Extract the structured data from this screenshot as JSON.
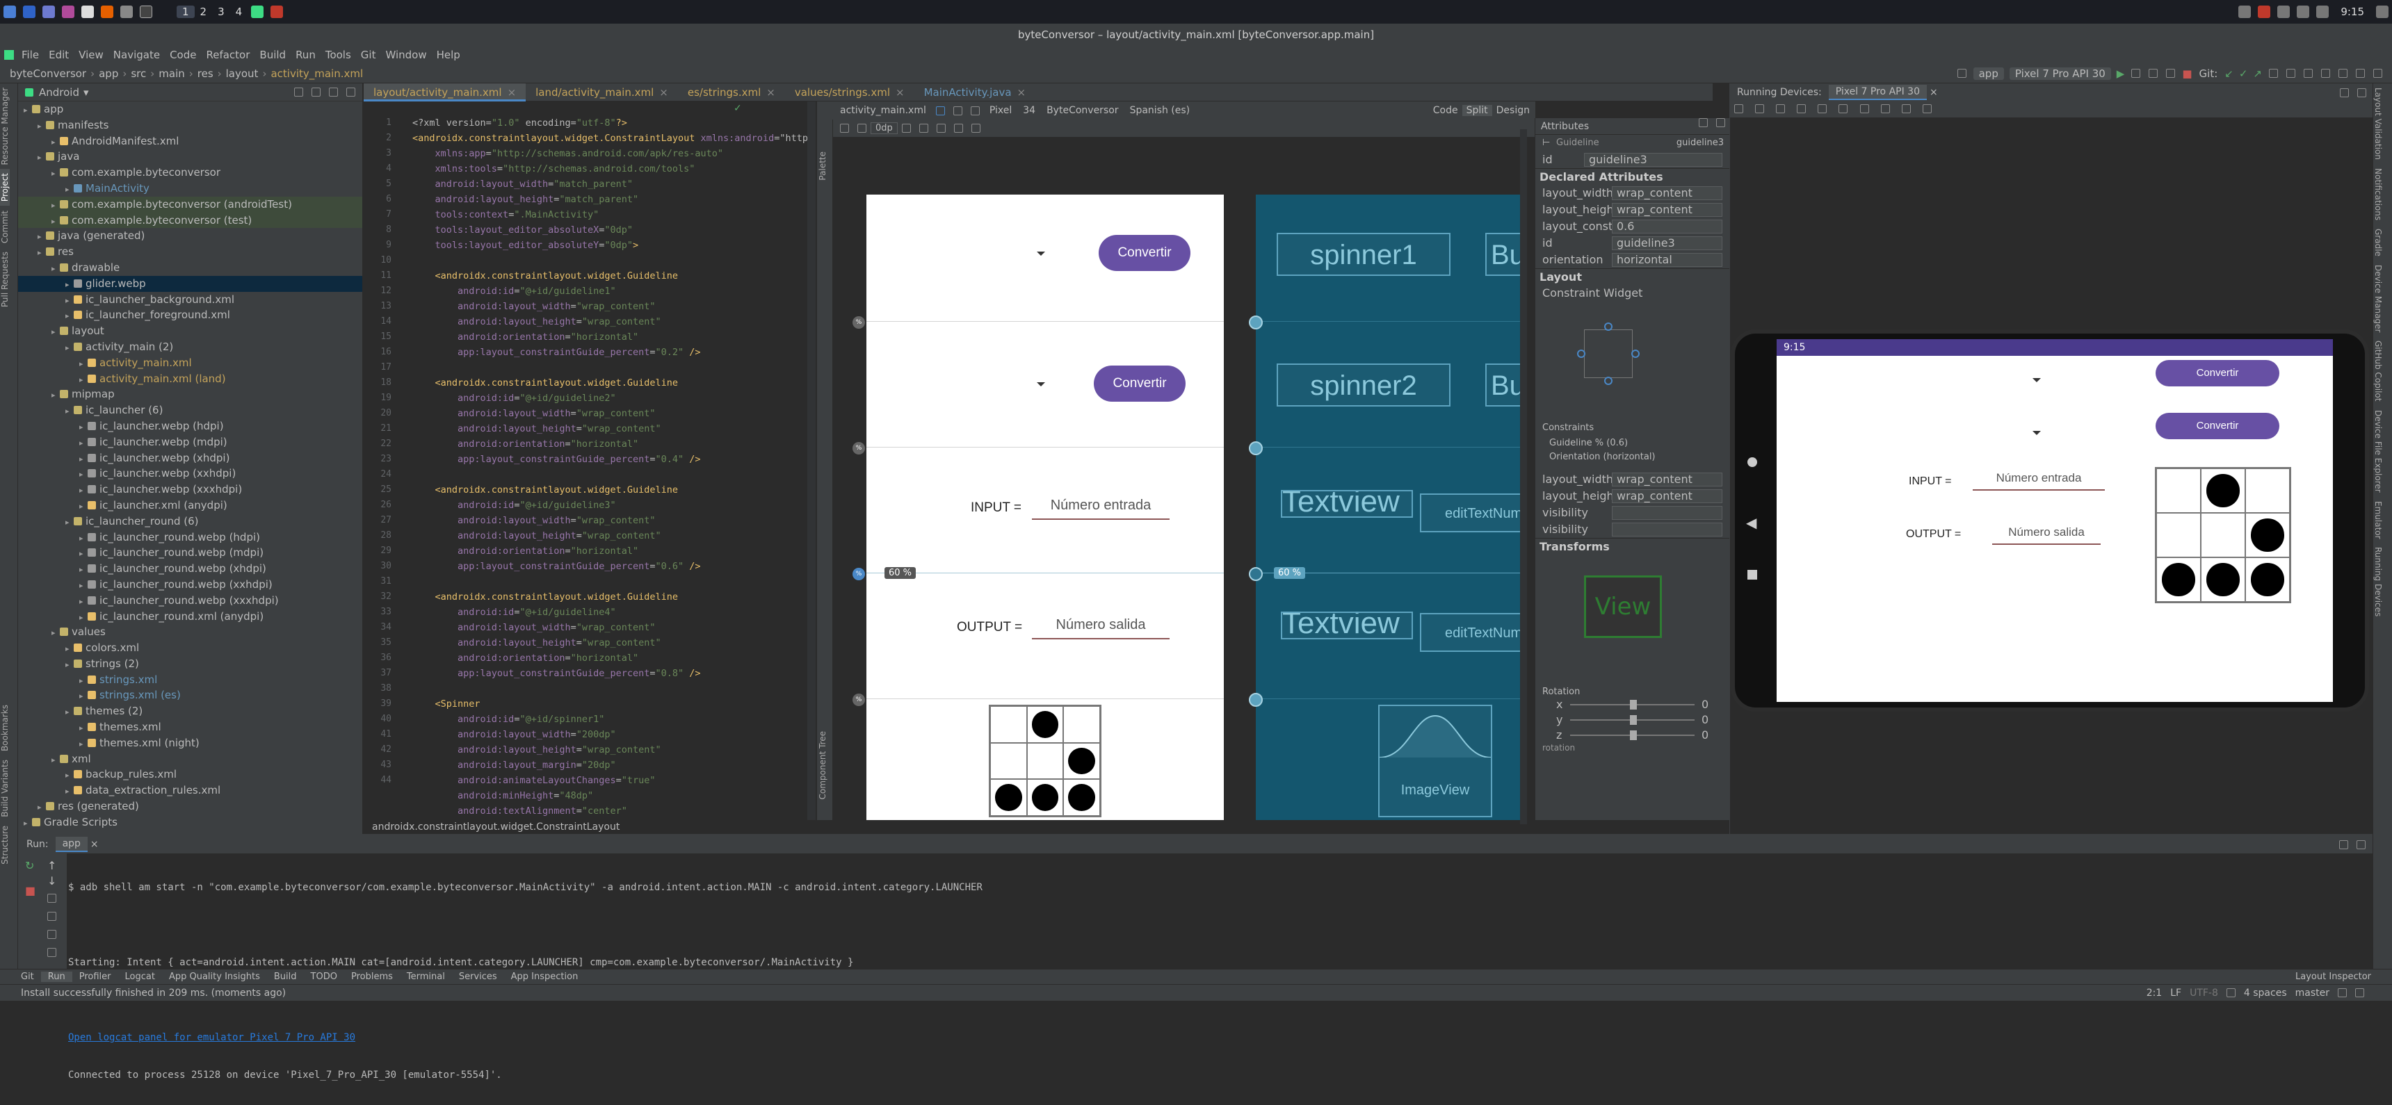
{
  "system_panel": {
    "workspaces": [
      "1",
      "2",
      "3",
      "4"
    ],
    "time": "9:15"
  },
  "window": {
    "title": "byteConversor – layout/activity_main.xml [byteConversor.app.main]"
  },
  "menu": [
    "File",
    "Edit",
    "View",
    "Navigate",
    "Code",
    "Refactor",
    "Build",
    "Run",
    "Tools",
    "Git",
    "Window",
    "Help"
  ],
  "breadcrumb": [
    "byteConversor",
    "app",
    "src",
    "main",
    "res",
    "layout",
    "activity_main.xml"
  ],
  "toolbar": {
    "run_config": "app",
    "device": "Pixel 7 Pro API 30",
    "git_label": "Git:"
  },
  "project": {
    "view": "Android",
    "tree": [
      {
        "d": 0,
        "t": "app",
        "c": "#c3b36a"
      },
      {
        "d": 1,
        "t": "manifests",
        "c": "#c3b36a"
      },
      {
        "d": 2,
        "t": "AndroidManifest.xml",
        "c": "#e8bf6a"
      },
      {
        "d": 1,
        "t": "java",
        "c": "#c3b36a"
      },
      {
        "d": 2,
        "t": "com.example.byteconversor",
        "c": "#c3b36a"
      },
      {
        "d": 3,
        "t": "MainActivity",
        "c": "#6897bb",
        "color": "#6897bb"
      },
      {
        "d": 2,
        "t": "com.example.byteconversor (androidTest)",
        "c": "#c3b36a",
        "hl": true
      },
      {
        "d": 2,
        "t": "com.example.byteconversor (test)",
        "c": "#c3b36a",
        "hl": true
      },
      {
        "d": 1,
        "t": "java (generated)",
        "c": "#c3b36a"
      },
      {
        "d": 1,
        "t": "res",
        "c": "#c3b36a"
      },
      {
        "d": 2,
        "t": "drawable",
        "c": "#c3b36a"
      },
      {
        "d": 3,
        "t": "glider.webp",
        "c": "#9b9b9b",
        "sel": true
      },
      {
        "d": 3,
        "t": "ic_launcher_background.xml",
        "c": "#e8bf6a"
      },
      {
        "d": 3,
        "t": "ic_launcher_foreground.xml",
        "c": "#e8bf6a"
      },
      {
        "d": 2,
        "t": "layout",
        "c": "#c3b36a"
      },
      {
        "d": 3,
        "t": "activity_main (2)",
        "c": "#c3b36a"
      },
      {
        "d": 4,
        "t": "activity_main.xml",
        "c": "#e8bf6a",
        "color": "#c4a35a"
      },
      {
        "d": 4,
        "t": "activity_main.xml (land)",
        "c": "#e8bf6a",
        "color": "#c4a35a"
      },
      {
        "d": 2,
        "t": "mipmap",
        "c": "#c3b36a"
      },
      {
        "d": 3,
        "t": "ic_launcher (6)",
        "c": "#c3b36a"
      },
      {
        "d": 4,
        "t": "ic_launcher.webp (hdpi)",
        "c": "#9b9b9b"
      },
      {
        "d": 4,
        "t": "ic_launcher.webp (mdpi)",
        "c": "#9b9b9b"
      },
      {
        "d": 4,
        "t": "ic_launcher.webp (xhdpi)",
        "c": "#9b9b9b"
      },
      {
        "d": 4,
        "t": "ic_launcher.webp (xxhdpi)",
        "c": "#9b9b9b"
      },
      {
        "d": 4,
        "t": "ic_launcher.webp (xxxhdpi)",
        "c": "#9b9b9b"
      },
      {
        "d": 4,
        "t": "ic_launcher.xml (anydpi)",
        "c": "#e8bf6a"
      },
      {
        "d": 3,
        "t": "ic_launcher_round (6)",
        "c": "#c3b36a"
      },
      {
        "d": 4,
        "t": "ic_launcher_round.webp (hdpi)",
        "c": "#9b9b9b"
      },
      {
        "d": 4,
        "t": "ic_launcher_round.webp (mdpi)",
        "c": "#9b9b9b"
      },
      {
        "d": 4,
        "t": "ic_launcher_round.webp (xhdpi)",
        "c": "#9b9b9b"
      },
      {
        "d": 4,
        "t": "ic_launcher_round.webp (xxhdpi)",
        "c": "#9b9b9b"
      },
      {
        "d": 4,
        "t": "ic_launcher_round.webp (xxxhdpi)",
        "c": "#9b9b9b"
      },
      {
        "d": 4,
        "t": "ic_launcher_round.xml (anydpi)",
        "c": "#e8bf6a"
      },
      {
        "d": 2,
        "t": "values",
        "c": "#c3b36a"
      },
      {
        "d": 3,
        "t": "colors.xml",
        "c": "#e8bf6a"
      },
      {
        "d": 3,
        "t": "strings (2)",
        "c": "#c3b36a"
      },
      {
        "d": 4,
        "t": "strings.xml",
        "c": "#e8bf6a",
        "color": "#6897bb"
      },
      {
        "d": 4,
        "t": "strings.xml (es)",
        "c": "#e8bf6a",
        "color": "#6897bb"
      },
      {
        "d": 3,
        "t": "themes (2)",
        "c": "#c3b36a"
      },
      {
        "d": 4,
        "t": "themes.xml",
        "c": "#e8bf6a"
      },
      {
        "d": 4,
        "t": "themes.xml (night)",
        "c": "#e8bf6a"
      },
      {
        "d": 2,
        "t": "xml",
        "c": "#c3b36a"
      },
      {
        "d": 3,
        "t": "backup_rules.xml",
        "c": "#e8bf6a"
      },
      {
        "d": 3,
        "t": "data_extraction_rules.xml",
        "c": "#e8bf6a"
      },
      {
        "d": 1,
        "t": "res (generated)",
        "c": "#c3b36a"
      },
      {
        "d": 0,
        "t": "Gradle Scripts",
        "c": "#c3b36a"
      }
    ]
  },
  "editor_tabs": [
    {
      "label": "layout/activity_main.xml",
      "active": true
    },
    {
      "label": "land/activity_main.xml"
    },
    {
      "label": "es/strings.xml"
    },
    {
      "label": "values/strings.xml"
    },
    {
      "label": "MainActivity.java",
      "blue": true
    }
  ],
  "code": {
    "line_numbers": [
      "1",
      "2",
      "3",
      "4",
      "5",
      "6",
      "7",
      "8",
      "9",
      "10",
      "11",
      "12",
      "13",
      "14",
      "15",
      "16",
      "17",
      "18",
      "19",
      "20",
      "21",
      "22",
      "23",
      "24",
      "25",
      "26",
      "27",
      "28",
      "29",
      "30",
      "31",
      "32",
      "33",
      "34",
      "35",
      "36",
      "37",
      "38",
      "39",
      "40",
      "41",
      "42",
      "43",
      "44"
    ],
    "lines": [
      "<?xml version=\"1.0\" encoding=\"utf-8\"?>",
      "<androidx.constraintlayout.widget.ConstraintLayout xmlns:android=\"http",
      "    xmlns:app=\"http://schemas.android.com/apk/res-auto\"",
      "    xmlns:tools=\"http://schemas.android.com/tools\"",
      "    android:layout_width=\"match_parent\"",
      "    android:layout_height=\"match_parent\"",
      "    tools:context=\".MainActivity\"",
      "    tools:layout_editor_absoluteX=\"0dp\"",
      "    tools:layout_editor_absoluteY=\"0dp\">",
      "",
      "    <androidx.constraintlayout.widget.Guideline",
      "        android:id=\"@+id/guideline1\"",
      "        android:layout_width=\"wrap_content\"",
      "        android:layout_height=\"wrap_content\"",
      "        android:orientation=\"horizontal\"",
      "        app:layout_constraintGuide_percent=\"0.2\" />",
      "",
      "    <androidx.constraintlayout.widget.Guideline",
      "        android:id=\"@+id/guideline2\"",
      "        android:layout_width=\"wrap_content\"",
      "        android:layout_height=\"wrap_content\"",
      "        android:orientation=\"horizontal\"",
      "        app:layout_constraintGuide_percent=\"0.4\" />",
      "",
      "    <androidx.constraintlayout.widget.Guideline",
      "        android:id=\"@+id/guideline3\"",
      "        android:layout_width=\"wrap_content\"",
      "        android:layout_height=\"wrap_content\"",
      "        android:orientation=\"horizontal\"",
      "        app:layout_constraintGuide_percent=\"0.6\" />",
      "",
      "    <androidx.constraintlayout.widget.Guideline",
      "        android:id=\"@+id/guideline4\"",
      "        android:layout_width=\"wrap_content\"",
      "        android:layout_height=\"wrap_content\"",
      "        android:orientation=\"horizontal\"",
      "        app:layout_constraintGuide_percent=\"0.8\" />",
      "",
      "    <Spinner",
      "        android:id=\"@+id/spinner1\"",
      "        android:layout_width=\"200dp\"",
      "        android:layout_height=\"wrap_content\"",
      "        android:layout_margin=\"20dp\"",
      "        android:animateLayoutChanges=\"true\"",
      "        android:minHeight=\"48dp\"",
      "        android:textAlignment=\"center\""
    ],
    "breadcrumb": "androidx.constraintlayout.widget.ConstraintLayout"
  },
  "design_toolbar": {
    "file": "activity_main.xml",
    "device": "Pixel",
    "api": "34",
    "theme": "ByteConversor",
    "locale": "Spanish (es)",
    "margin": "0dp",
    "modes": [
      "Code",
      "Split",
      "Design"
    ],
    "palette": "Palette",
    "component_tree": "Component Tree"
  },
  "design": {
    "button1": "Convertir",
    "button2": "Convertir",
    "input_label": "INPUT =",
    "input_hint": "Número entrada",
    "output_label": "OUTPUT =",
    "output_hint": "Número salida",
    "guide_percent": "60 %",
    "bp": {
      "spinner1": "spinner1",
      "spinner2": "spinner2",
      "button": "But",
      "textview": "Textview",
      "edit1": "editTextNumbe",
      "edit2": "editTextNumbe",
      "imageview": "ImageView"
    }
  },
  "glider": [
    [
      0,
      1,
      0
    ],
    [
      0,
      0,
      1
    ],
    [
      1,
      1,
      1
    ]
  ],
  "attributes": {
    "title": "Attributes",
    "component": "Guideline",
    "component_id": "guideline3",
    "id_label": "id",
    "id_value": "guideline3",
    "declared_title": "Declared Attributes",
    "declared": [
      {
        "k": "layout_width",
        "v": "wrap_content"
      },
      {
        "k": "layout_height",
        "v": "wrap_content"
      },
      {
        "k": "layout_constr...",
        "v": "0.6"
      },
      {
        "k": "id",
        "v": "guideline3"
      },
      {
        "k": "orientation",
        "v": "horizontal"
      }
    ],
    "layout_title": "Layout",
    "constraint_widget": "Constraint Widget",
    "constraints_title": "Constraints",
    "constraint1": "Guideline % (0.6)",
    "constraint2": "Orientation (horizontal)",
    "layout_rows": [
      {
        "k": "layout_width",
        "v": "wrap_content"
      },
      {
        "k": "layout_height",
        "v": "wrap_content"
      },
      {
        "k": "visibility",
        "v": ""
      },
      {
        "k": "visibility",
        "v": ""
      }
    ],
    "transforms_title": "Transforms",
    "view_label": "View",
    "rotation_label": "Rotation",
    "rot": [
      {
        "k": "x",
        "v": "0"
      },
      {
        "k": "y",
        "v": "0"
      },
      {
        "k": "z",
        "v": "0"
      }
    ],
    "rotation_bottom": "rotation"
  },
  "running": {
    "title": "Running Devices:",
    "device_tab": "Pixel 7 Pro API 30"
  },
  "phone": {
    "time": "9:15",
    "button1": "Convertir",
    "button2": "Convertir",
    "input_label": "INPUT =",
    "input_hint": "Número entrada",
    "output_label": "OUTPUT =",
    "output_hint": "Número salida"
  },
  "run": {
    "title": "Run:",
    "config": "app",
    "lines": [
      "$ adb shell am start -n \"com.example.byteconversor/com.example.byteconversor.MainActivity\" -a android.intent.action.MAIN -c android.intent.category.LAUNCHER",
      "",
      "Starting: Intent { act=android.intent.action.MAIN cat=[android.intent.category.LAUNCHER] cmp=com.example.byteconversor/.MainActivity }",
      "",
      "",
      "Connected to process 25128 on device 'Pixel_7_Pro_API_30 [emulator-5554]'."
    ],
    "link": "Open logcat panel for emulator Pixel 7 Pro API 30"
  },
  "bottom_tabs": [
    "Git",
    "Run",
    "Profiler",
    "Logcat",
    "App Quality Insights",
    "Build",
    "TODO",
    "Problems",
    "Terminal",
    "Services",
    "App Inspection"
  ],
  "layout_inspector": "Layout Inspector",
  "status": {
    "message": "Install successfully finished in 209 ms. (moments ago)",
    "pos": "2:1",
    "sep": "LF",
    "enc": "UTF-8",
    "indent": "4 spaces",
    "branch": "master"
  },
  "left_strip": [
    "Resource Manager",
    "Project",
    "Commit",
    "Pull Requests",
    "Bookmarks",
    "Build Variants",
    "Structure"
  ],
  "right_strip": [
    "Layout Validation",
    "Notifications",
    "Gradle",
    "Device Manager",
    "GitHub Copilot",
    "Device File Explorer",
    "Emulator",
    "Running Devices"
  ]
}
